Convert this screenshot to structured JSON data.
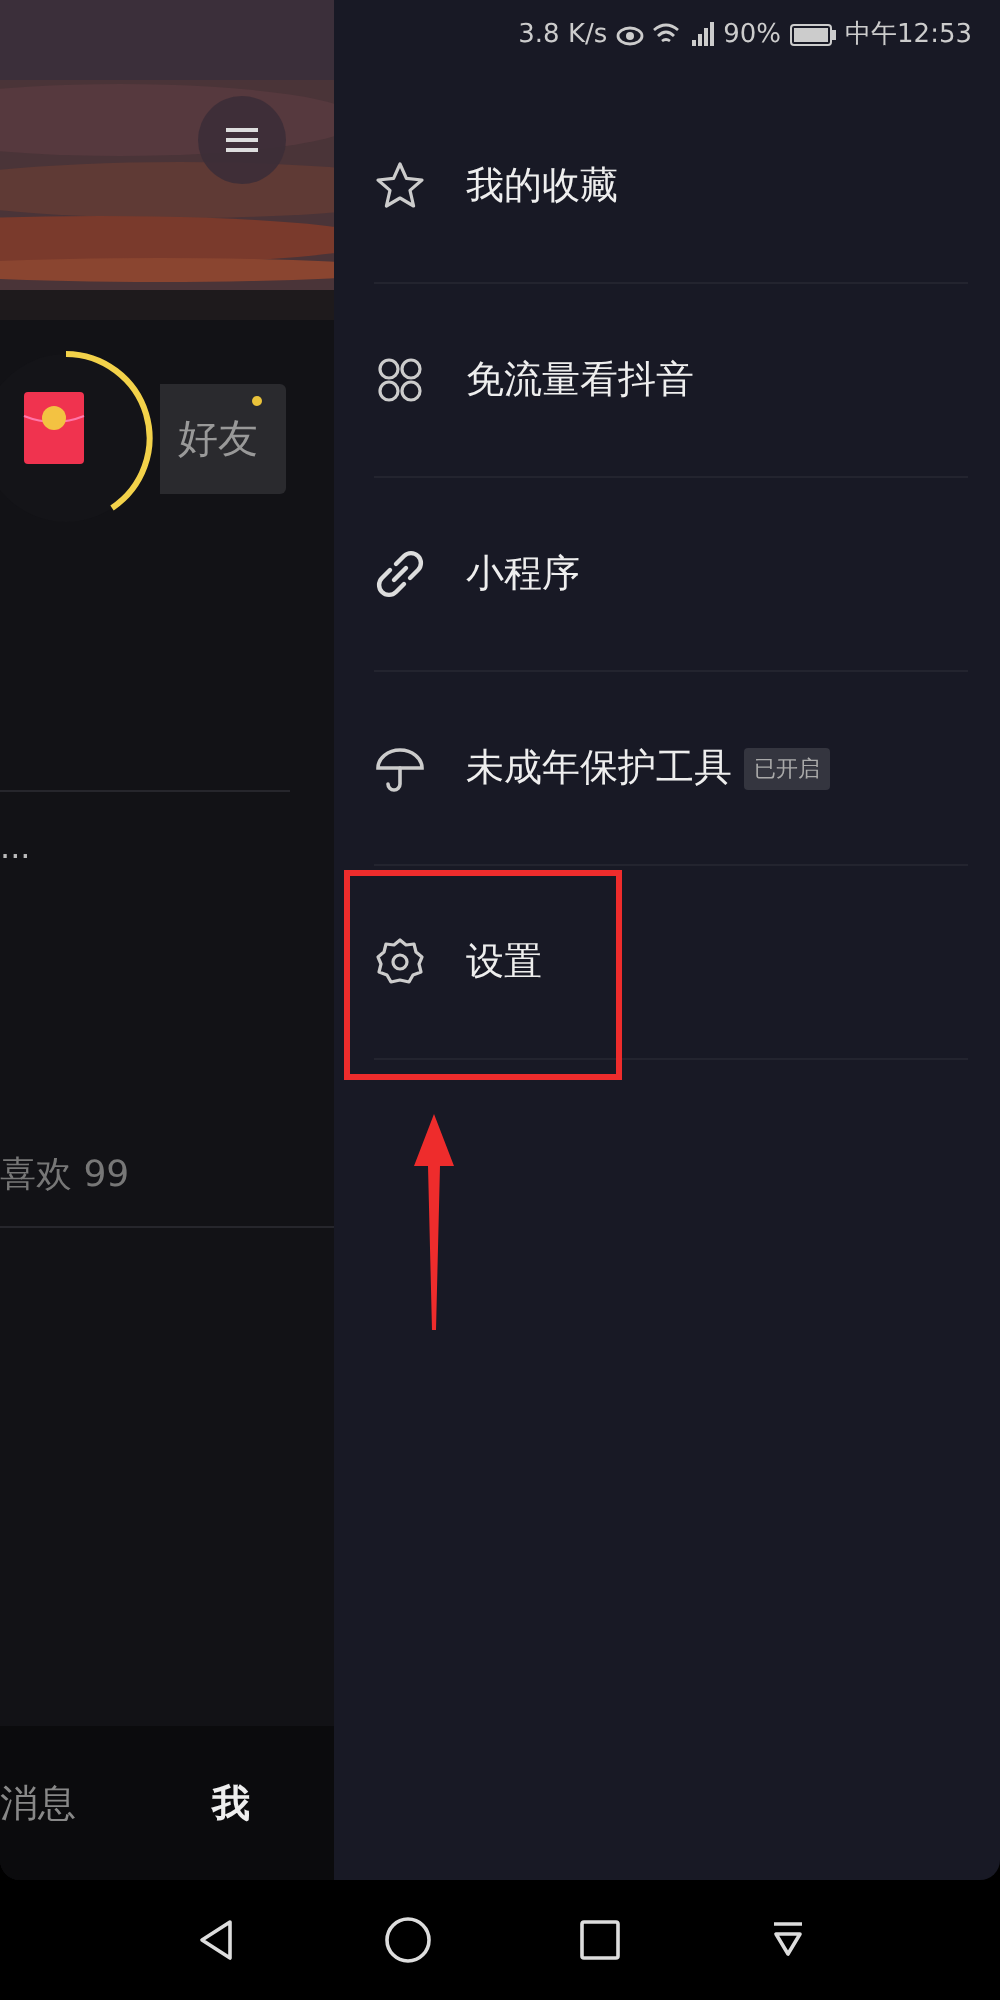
{
  "status_bar": {
    "speed": "3.8 K/s",
    "battery": "90%",
    "time": "中午12:53"
  },
  "profile": {
    "friends_button": {
      "label": "好友",
      "unread": true
    },
    "truncated_text": "...",
    "likes": "喜欢 99"
  },
  "tab_bar": [
    {
      "label": "消息",
      "selected": false
    },
    {
      "label": "我",
      "selected": true
    }
  ],
  "drawer": {
    "items": [
      {
        "label": "我的收藏"
      },
      {
        "label": "免流量看抖音"
      },
      {
        "label": "小程序"
      },
      {
        "label": "未成年保护工具",
        "badge": "已开启"
      },
      {
        "label": "设置",
        "highlighted": true
      }
    ]
  }
}
